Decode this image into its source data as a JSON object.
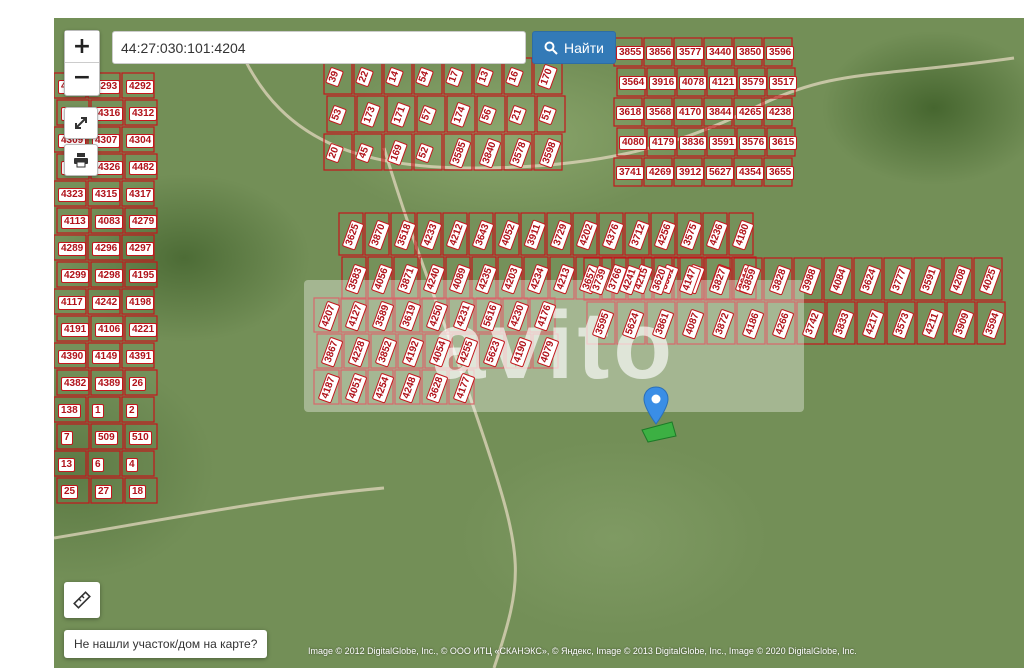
{
  "search": {
    "value": "44:27:030:101:4204",
    "button_label": "Найти"
  },
  "controls": {
    "zoom_in": "+",
    "zoom_out": "−"
  },
  "icons": [
    "search-icon",
    "fullscreen-icon",
    "print-icon",
    "ruler-icon",
    "location-pin-icon"
  ],
  "colors": {
    "plot_border": "#c4161c",
    "primary_button": "#337ab7",
    "selected_plot": "#3cb043",
    "pin": "#3a8ee6"
  },
  "watermark": "avito",
  "not_found_label": "Не нашли участок/дом на карте?",
  "attribution": "Image © 2012 DigitalGlobe, Inc., © ООО ИТЦ «СКАНЭКС», © Яндекс, Image © 2013 DigitalGlobe, Inc., Image © 2020 DigitalGlobe, Inc.",
  "plots": [
    "4120",
    "4293",
    "4292",
    "4244",
    "4316",
    "4312",
    "4309",
    "4307",
    "4304",
    "4328",
    "4326",
    "4482",
    "4323",
    "4315",
    "4317",
    "4113",
    "4083",
    "4279",
    "4289",
    "4296",
    "4297",
    "4299",
    "4298",
    "4195",
    "4117",
    "4242",
    "4198",
    "4191",
    "4106",
    "4221",
    "4390",
    "4149",
    "4391",
    "4382",
    "4389",
    "26",
    "138",
    "1",
    "2",
    "7",
    "509",
    "510",
    "13",
    "6",
    "4",
    "25",
    "27",
    "18",
    "39",
    "22",
    "14",
    "54",
    "17",
    "13",
    "16",
    "170",
    "53",
    "173",
    "171",
    "57",
    "174",
    "56",
    "21",
    "51",
    "20",
    "45",
    "169",
    "52",
    "3585",
    "3840",
    "3578",
    "3598",
    "3855",
    "3856",
    "3577",
    "3440",
    "3850",
    "3596",
    "3564",
    "3916",
    "4078",
    "4121",
    "3579",
    "3517",
    "3618",
    "3568",
    "4170",
    "3844",
    "4265",
    "4238",
    "4080",
    "4179",
    "3836",
    "3591",
    "3576",
    "3615",
    "3741",
    "4269",
    "3912",
    "5627",
    "4354",
    "3655",
    "3625",
    "3870",
    "3518",
    "4233",
    "4212",
    "3643",
    "4052",
    "3911",
    "3729",
    "4202",
    "4376",
    "3712",
    "4256",
    "3575",
    "4236",
    "4180",
    "3583",
    "4056",
    "3871",
    "4240",
    "4089",
    "4235",
    "4203",
    "4234",
    "4213",
    "3657",
    "3766",
    "4215",
    "3581",
    "3622",
    "4184",
    "3616",
    "3739",
    "4241",
    "3620",
    "4147",
    "3827",
    "3859",
    "3828",
    "3988",
    "4084",
    "3624",
    "3777",
    "3591",
    "4208",
    "4025",
    "3595",
    "5624",
    "3861",
    "4087",
    "3872",
    "4186",
    "4266",
    "3742",
    "3833",
    "4217",
    "3573",
    "4211",
    "3909",
    "3594",
    "4207",
    "4127",
    "3589",
    "3619",
    "4250",
    "4231",
    "5616",
    "4230",
    "4176",
    "3867",
    "4228",
    "3852",
    "4192",
    "4054",
    "4255",
    "5623",
    "4190",
    "4079",
    "4187",
    "4051",
    "4254",
    "4248",
    "3628",
    "4177"
  ]
}
